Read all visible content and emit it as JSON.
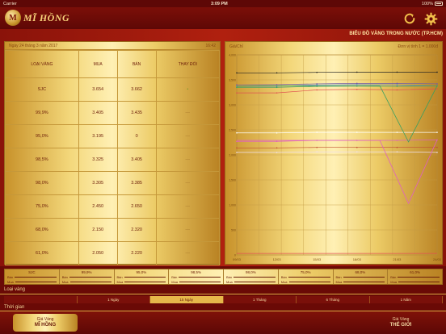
{
  "status": {
    "carrier": "Carrier",
    "time": "3:09 PM",
    "battery": "100%"
  },
  "app": {
    "logo_mark": "M",
    "logo_text": "MĨ HỒNG"
  },
  "chart_section_title": "BIỂU ĐỒ VÀNG TRONG NƯỚC (TP.HCM)",
  "table": {
    "date": "Ngày 24 tháng 3 năm 2017",
    "time": "16:42",
    "headers": [
      "LOẠI VÀNG",
      "MUA",
      "BÁN",
      "THAY ĐỔI"
    ],
    "rows": [
      {
        "type": "SJC",
        "buy": "3.654",
        "sell": "3.662",
        "change": "•"
      },
      {
        "type": "99,9%",
        "buy": "3.405",
        "sell": "3.435",
        "change": "—"
      },
      {
        "type": "95,0%",
        "buy": "3.195",
        "sell": "0",
        "change": "—"
      },
      {
        "type": "98,5%",
        "buy": "3.325",
        "sell": "3.405",
        "change": "—"
      },
      {
        "type": "98,0%",
        "buy": "3.305",
        "sell": "3.385",
        "change": "—"
      },
      {
        "type": "75,0%",
        "buy": "2.450",
        "sell": "2.650",
        "change": "—"
      },
      {
        "type": "68,0%",
        "buy": "2.150",
        "sell": "2.320",
        "change": "—"
      },
      {
        "type": "61,0%",
        "buy": "2.050",
        "sell": "2.220",
        "change": "—"
      }
    ]
  },
  "chart_head": {
    "label": "Giá/Chỉ",
    "unit": "Đơn vị tính 1 = 1.000đ"
  },
  "chart_data": {
    "type": "line",
    "x": [
      "09/03",
      "12/03",
      "15/03",
      "18/03",
      "21/03",
      "24/03"
    ],
    "ylim": [
      0,
      4000
    ],
    "y_ticks": [
      "0",
      "500",
      "1,000",
      "1,500",
      "2,000",
      "2,500",
      "3,000",
      "3,500",
      "4,000"
    ],
    "grid": true,
    "series": [
      {
        "color": "#222222",
        "values": [
          3640,
          3640,
          3650,
          3655,
          3655,
          3654
        ]
      },
      {
        "color": "#6f5aa8",
        "values": [
          3400,
          3405,
          3420,
          3430,
          3430,
          3420
        ]
      },
      {
        "color": "#4a88c8",
        "values": [
          3370,
          3372,
          3400,
          3405,
          3400,
          3380
        ]
      },
      {
        "color": "#3aa060",
        "values": [
          3350,
          3350,
          3370,
          3375,
          3370,
          3380
        ]
      },
      {
        "color": "#e05050",
        "values": [
          3240,
          3240,
          3300,
          3310,
          3300,
          3320
        ]
      },
      {
        "color": "#ffffff",
        "values": [
          2440,
          2440,
          2450,
          2450,
          2450,
          2450
        ]
      },
      {
        "color": "#e060c0",
        "values": [
          2270,
          2270,
          2290,
          2290,
          2290,
          2300
        ]
      },
      {
        "color": "#c05030",
        "values": [
          2140,
          2140,
          2150,
          2150,
          2150,
          2150
        ]
      },
      {
        "color": "#f0e0f0",
        "values": [
          2050,
          2050,
          2060,
          2060,
          2060,
          2050
        ]
      }
    ],
    "spikes": [
      {
        "color": "#3aa060",
        "values": [
          3370,
          3380,
          3380,
          3380,
          3380,
          3380,
          2260,
          3380
        ]
      },
      {
        "color": "#e060c0",
        "values": [
          2290,
          2290,
          2290,
          2290,
          2290,
          2290,
          1030,
          2300
        ]
      },
      {
        "color": "#e05050",
        "values": [
          30,
          30,
          30,
          30,
          30,
          30,
          30,
          30
        ]
      }
    ]
  },
  "summary": [
    {
      "name": "SJC",
      "buy": "Mua",
      "sell": "Bán"
    },
    {
      "name": "99,9%",
      "buy": "Mua",
      "sell": "Bán"
    },
    {
      "name": "95,0%",
      "buy": "Mua",
      "sell": "Bán"
    },
    {
      "name": "98,5%",
      "buy": "Mua",
      "sell": "Bán"
    },
    {
      "name": "98,0%",
      "buy": "Mua",
      "sell": "Bán"
    },
    {
      "name": "75,0%",
      "buy": "Mua",
      "sell": "Bán"
    },
    {
      "name": "68,0%",
      "buy": "Mua",
      "sell": "Bán"
    },
    {
      "name": "61,0%",
      "buy": "Mua",
      "sell": "Bán"
    }
  ],
  "section_labels": {
    "gold_type": "Loại vàng",
    "time": "Thời gian"
  },
  "time_tabs": [
    "",
    "1 Ngày",
    "15 Ngày",
    "1 Tháng",
    "6 Tháng",
    "1 Năm"
  ],
  "active_tab": 2,
  "bottom_nav": {
    "left_line1": "Giá Vàng",
    "left_line2": "MĨ HỒNG",
    "right_line1": "Giá Vàng",
    "right_line2": "THẾ GIỚI"
  },
  "colors": {
    "accent": "#e6b74a",
    "background": "#6a0a06"
  }
}
